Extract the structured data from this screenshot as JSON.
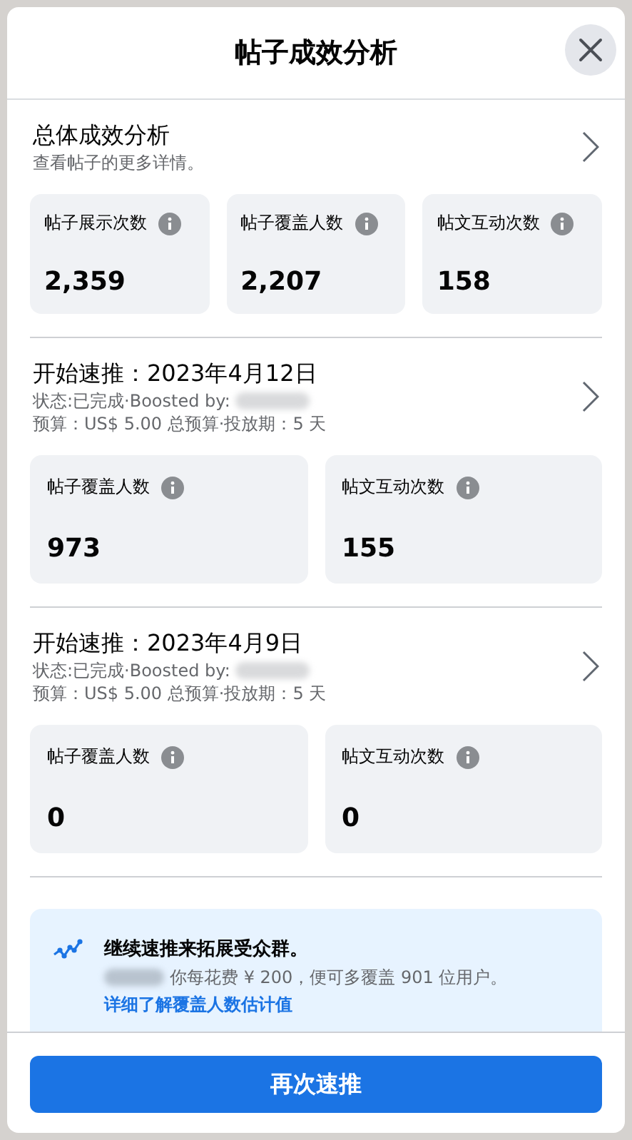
{
  "dialog": {
    "title": "帖子成效分析"
  },
  "overview": {
    "title": "总体成效分析",
    "subtitle": "查看帖子的更多详情。",
    "stats": [
      {
        "label": "帖子展示次数",
        "value": "2,359"
      },
      {
        "label": "帖子覆盖人数",
        "value": "2,207"
      },
      {
        "label": "帖文互动次数",
        "value": "158"
      }
    ]
  },
  "boosts": [
    {
      "title": "开始速推：2023年4月12日",
      "status": "状态:已完成·Boosted by:",
      "budget": "预算：US$ 5.00 总预算·投放期：5 天",
      "stats": [
        {
          "label": "帖子覆盖人数",
          "value": "973"
        },
        {
          "label": "帖文互动次数",
          "value": "155"
        }
      ]
    },
    {
      "title": "开始速推：2023年4月9日",
      "status": "状态:已完成·Boosted by:",
      "budget": "预算：US$ 5.00 总预算·投放期：5 天",
      "stats": [
        {
          "label": "帖子覆盖人数",
          "value": "0"
        },
        {
          "label": "帖文互动次数",
          "value": "0"
        }
      ]
    }
  ],
  "promo": {
    "title": "继续速推来拓展受众群。",
    "text": "你每花费 ¥ 200，便可多覆盖 901 位用户。",
    "link": "详细了解覆盖人数估计值"
  },
  "footer": {
    "button": "再次速推"
  }
}
